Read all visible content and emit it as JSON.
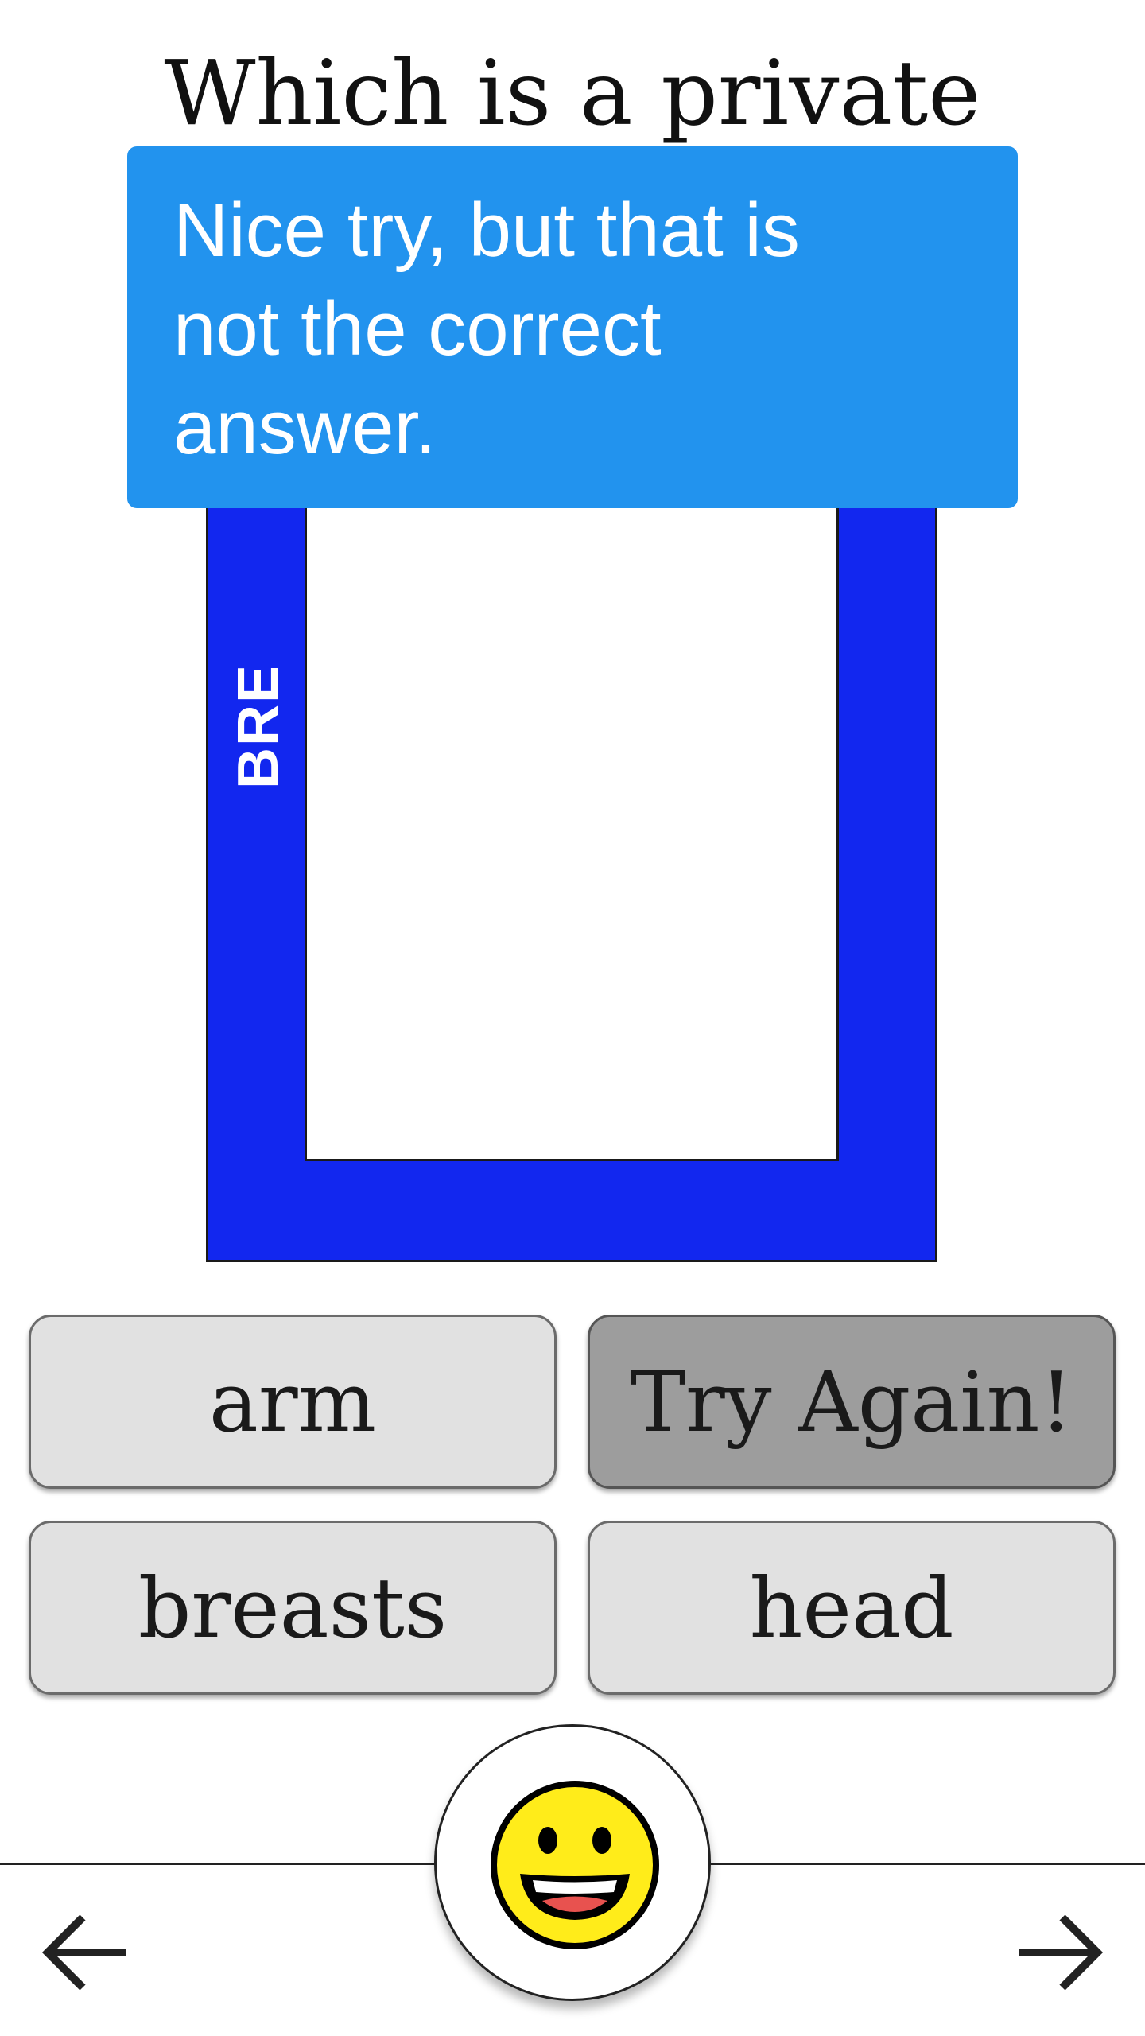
{
  "question": {
    "title": "Which is a private"
  },
  "card": {
    "label": "BREA",
    "background_color": "#1227ef"
  },
  "feedback": {
    "message": "Nice try, but that is not the correct answer.",
    "background_color": "#2293ee"
  },
  "answers": [
    {
      "label": "arm",
      "state": "default"
    },
    {
      "label": "Try Again!",
      "state": "incorrect"
    },
    {
      "label": "breasts",
      "state": "default"
    },
    {
      "label": "head",
      "state": "default"
    }
  ],
  "footer": {
    "center_icon": "grinning-face-icon",
    "prev_icon": "arrow-left-icon",
    "next_icon": "arrow-right-icon"
  }
}
